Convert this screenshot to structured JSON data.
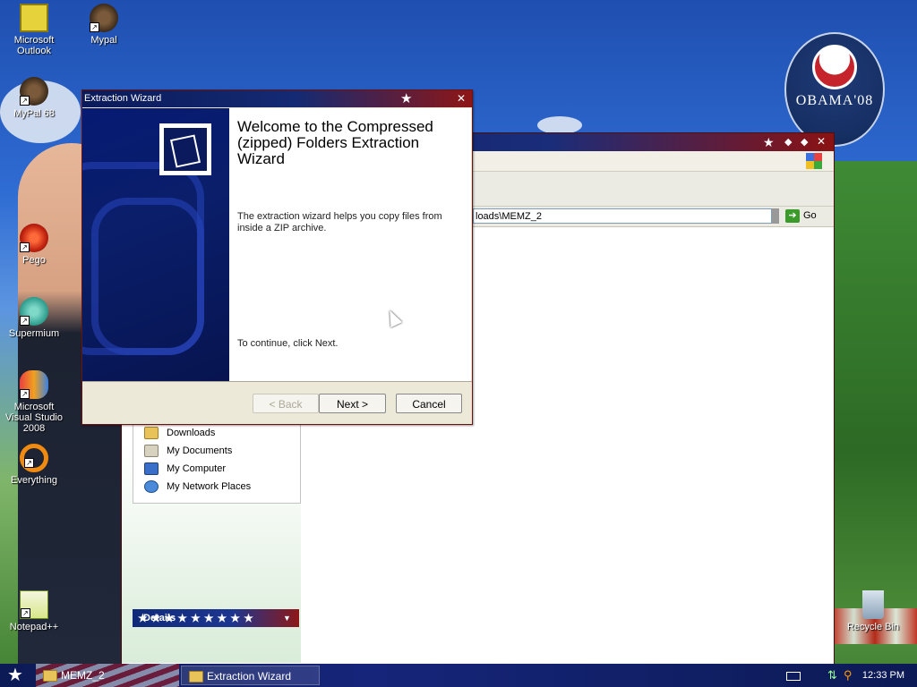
{
  "desktop": {
    "icons": [
      {
        "label": "Microsoft Outlook",
        "icon": "outlook-icon"
      },
      {
        "label": "Mypal",
        "icon": "mypal-icon"
      },
      {
        "label": "MyPal 68",
        "icon": "mypal68-icon"
      },
      {
        "label": "Pego",
        "icon": "pego-icon"
      },
      {
        "label": "Supermium",
        "icon": "supermium-icon"
      },
      {
        "label": "Microsoft Visual Studio 2008",
        "icon": "visual-studio-icon"
      },
      {
        "label": "Everything",
        "icon": "everything-icon"
      },
      {
        "label": "Notepad++",
        "icon": "notepad-plus-plus-icon"
      },
      {
        "label": "Recycle Bin",
        "icon": "recycle-bin-icon"
      }
    ],
    "wallpaper_badge": "OBAMA'08"
  },
  "explorer": {
    "address": "loads\\MEMZ_2",
    "go_label": "Go",
    "tasks": [
      {
        "label": "Downloads",
        "icon": "folder-icon"
      },
      {
        "label": "My Documents",
        "icon": "documents-icon"
      },
      {
        "label": "My Computer",
        "icon": "computer-icon"
      },
      {
        "label": "My Network Places",
        "icon": "network-icon"
      }
    ],
    "details_label": "Details"
  },
  "wizard": {
    "title": "Extraction Wizard",
    "heading": "Welcome to the Compressed (zipped) Folders Extraction Wizard",
    "description": "The extraction wizard helps you copy files from inside a ZIP archive.",
    "continue_text": "To continue, click Next.",
    "buttons": {
      "back": "< Back",
      "next": "Next >",
      "cancel": "Cancel"
    }
  },
  "taskbar": {
    "items": [
      {
        "label": "MEMZ_2"
      },
      {
        "label": "Extraction Wizard"
      }
    ],
    "clock": "12:33 PM"
  },
  "colors": {
    "title_blue": "#0b1b5a",
    "title_red": "#8e1616",
    "wizard_side": "#061a73"
  }
}
